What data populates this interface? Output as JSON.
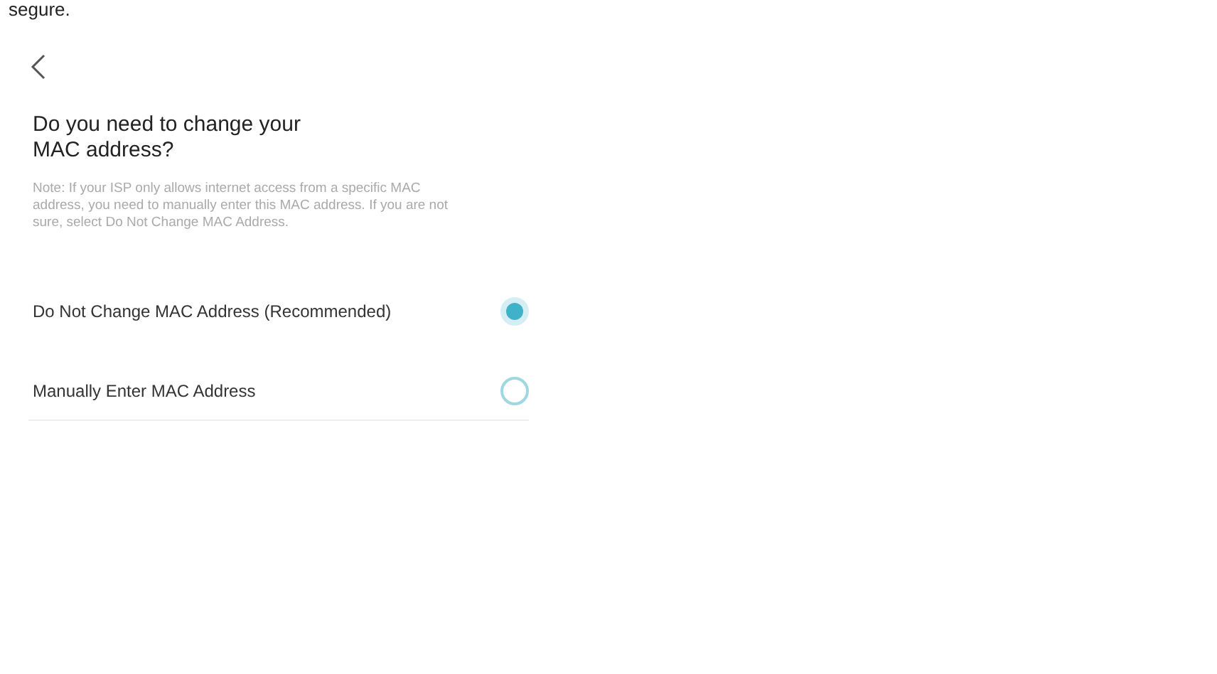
{
  "top_text": "segure.",
  "title": "Do you need to change your MAC address?",
  "note": "Note: If your ISP only allows internet access from a specific MAC address, you need to manually enter this MAC address. If you are not sure, select Do Not Change MAC Address.",
  "options": [
    {
      "label": "Do Not Change MAC Address (Recommended)",
      "selected": true
    },
    {
      "label": "Manually Enter MAC Address",
      "selected": false
    }
  ]
}
